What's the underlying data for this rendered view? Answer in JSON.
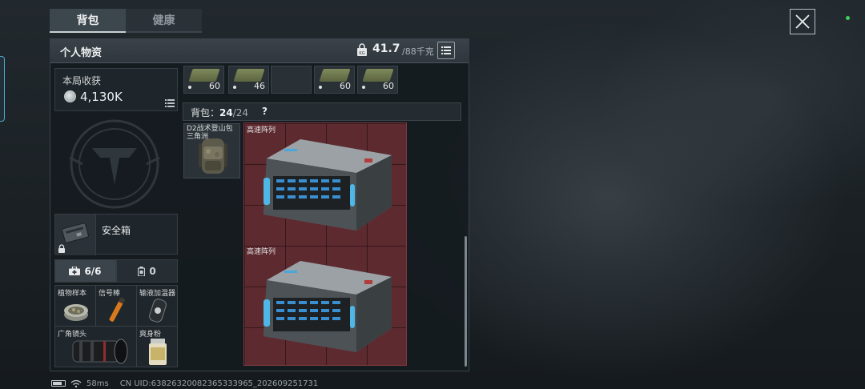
{
  "tabs": [
    {
      "label": "背包",
      "active": true
    },
    {
      "label": "健康",
      "active": false
    }
  ],
  "header": {
    "title": "个人物资",
    "weight_value": "41.7",
    "weight_max": "/88千克",
    "weight_icon_text": "KG",
    "weight_icon": "weight-lock-icon",
    "list_icon": "list-icon"
  },
  "harvest": {
    "label": "本局收获",
    "value": "4,130K",
    "icon": "coin-icon"
  },
  "safebox": {
    "label": "安全箱",
    "icon": "lock-icon"
  },
  "pouch_tabs": [
    {
      "label": "6/6",
      "icon": "medkit-icon",
      "active": true
    },
    {
      "label": "0",
      "icon": "canister-icon",
      "active": false
    }
  ],
  "pouch_items": [
    {
      "label": "植物样本"
    },
    {
      "label": "信号棒"
    },
    {
      "label": "输液加温器"
    },
    {
      "label": "广角镜头"
    },
    {
      "label": "爽身粉"
    }
  ],
  "ammo_row": [
    {
      "count": "60"
    },
    {
      "count": "46"
    },
    {
      "count": ""
    },
    {
      "count": "60"
    },
    {
      "count": "60"
    }
  ],
  "bag": {
    "label": "背包：",
    "count": "24",
    "max": "/24",
    "help": "?"
  },
  "backpack": {
    "label": "D2战术登山包 三角洲"
  },
  "servers": [
    {
      "label": "高速阵列"
    },
    {
      "label": "高速阵列"
    }
  ],
  "statusbar": {
    "ping": "58ms",
    "uid": "CN UID:63826320082365333965_202609251731"
  },
  "colors": {
    "accent": "#4fa8c9",
    "item_grid_bg": "#5d2a2f",
    "online_dot": "#3fcf5c"
  }
}
